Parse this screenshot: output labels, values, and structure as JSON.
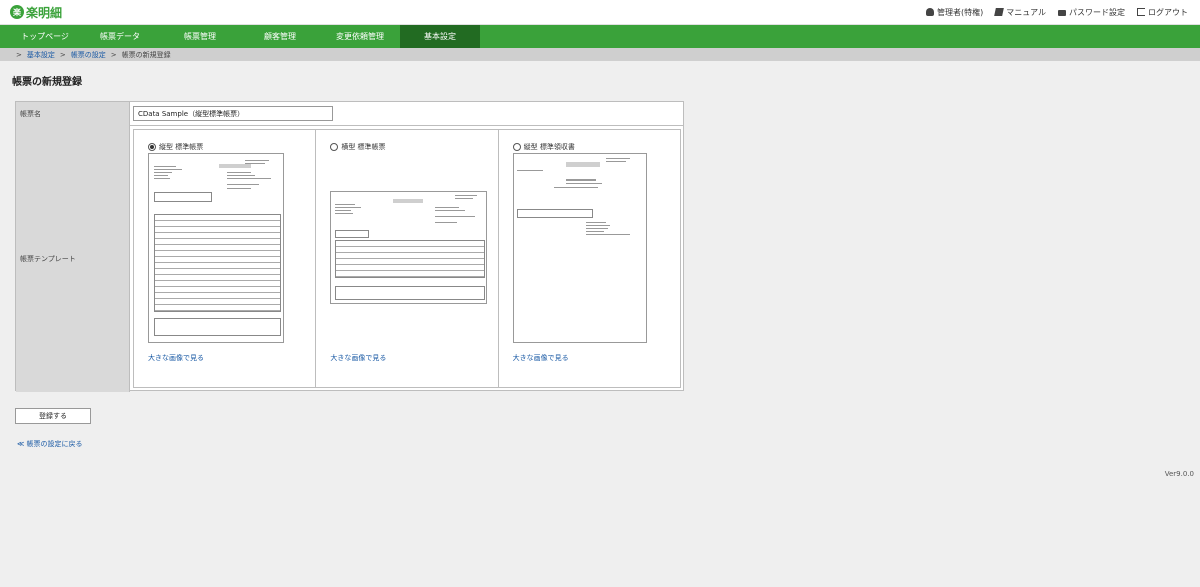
{
  "app": {
    "logo_mark": "楽",
    "logo_text": "楽明細"
  },
  "header_links": [
    {
      "icon": "user-icon",
      "label": "管理者(特権)"
    },
    {
      "icon": "manual-icon",
      "label": "マニュアル"
    },
    {
      "icon": "lock-icon",
      "label": "パスワード設定"
    },
    {
      "icon": "logout-icon",
      "label": "ログアウト"
    }
  ],
  "nav": [
    {
      "label": "トップページ",
      "active": false
    },
    {
      "label": "帳票データ",
      "active": false
    },
    {
      "label": "帳票管理",
      "active": false
    },
    {
      "label": "顧客管理",
      "active": false
    },
    {
      "label": "変更依頼管理",
      "active": false
    },
    {
      "label": "基本設定",
      "active": true
    }
  ],
  "breadcrumb": {
    "sep": ">",
    "items": [
      "基本設定",
      "帳票の設定",
      "帳票の新規登録"
    ]
  },
  "page_title": "帳票の新規登録",
  "form": {
    "name_label": "帳票名",
    "name_value": "CData Sample（縦型標準帳票）",
    "template_label": "帳票テンプレート",
    "templates": [
      {
        "label": "縦型 標準帳票",
        "selected": true,
        "link": "大きな画像で見る"
      },
      {
        "label": "横型 標準帳票",
        "selected": false,
        "link": "大きな画像で見る"
      },
      {
        "label": "縦型 標準領収書",
        "selected": false,
        "link": "大きな画像で見る"
      }
    ],
    "submit_label": "登録する"
  },
  "back_link": "≪ 帳票の設定に戻る",
  "version": "Ver9.0.0",
  "colors": {
    "brand_green": "#3aa23a",
    "nav_active": "#226b22",
    "link_blue": "#1a5aa5"
  }
}
